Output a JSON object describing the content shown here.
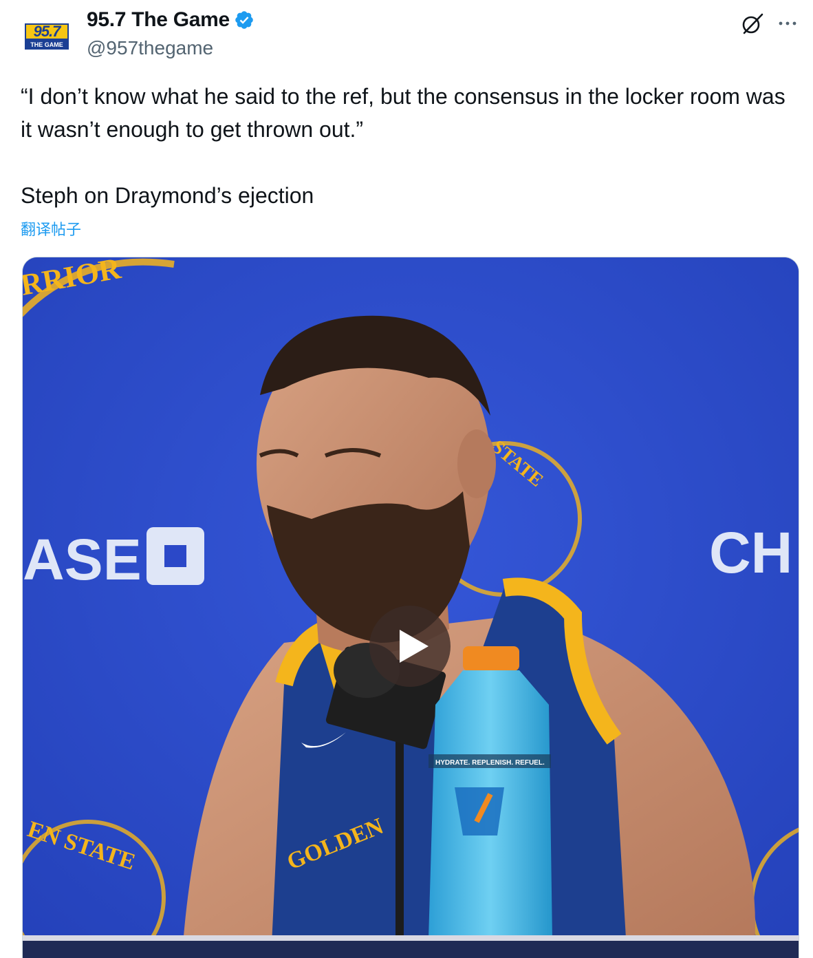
{
  "account": {
    "display_name": "95.7 The Game",
    "handle": "@957thegame",
    "verified_icon": "verified-badge-icon",
    "logo_number": "95.7",
    "logo_subtitle": "THE GAME"
  },
  "actions": {
    "grok_icon": "grok-icon",
    "more_icon": "more-options-icon"
  },
  "tweet": {
    "text": "“I don’t know what he said to the ref, but the consensus in the locker room was it wasn’t enough to get thrown out.”\n\nSteph on Draymond’s ejection",
    "translate_label": "翻译帖子"
  },
  "media": {
    "type": "video",
    "play_icon": "play-icon",
    "backdrop_texts": {
      "warriors_partial": "RRIOR",
      "chase_left": "ASE",
      "chase_right": "CH",
      "state_upper": "STATE",
      "golden_state_lower": "EN STATE",
      "jersey": "GOLDEN",
      "bottle_band": "HYDRATE. REPLENISH. REFUEL."
    },
    "colors": {
      "backdrop_blue": "#2b48c8",
      "warriors_gold": "#f4b51c",
      "jersey_blue": "#1d3f8f",
      "gatorade_blue": "#3fb2e3",
      "cap_orange": "#f08a21"
    }
  }
}
